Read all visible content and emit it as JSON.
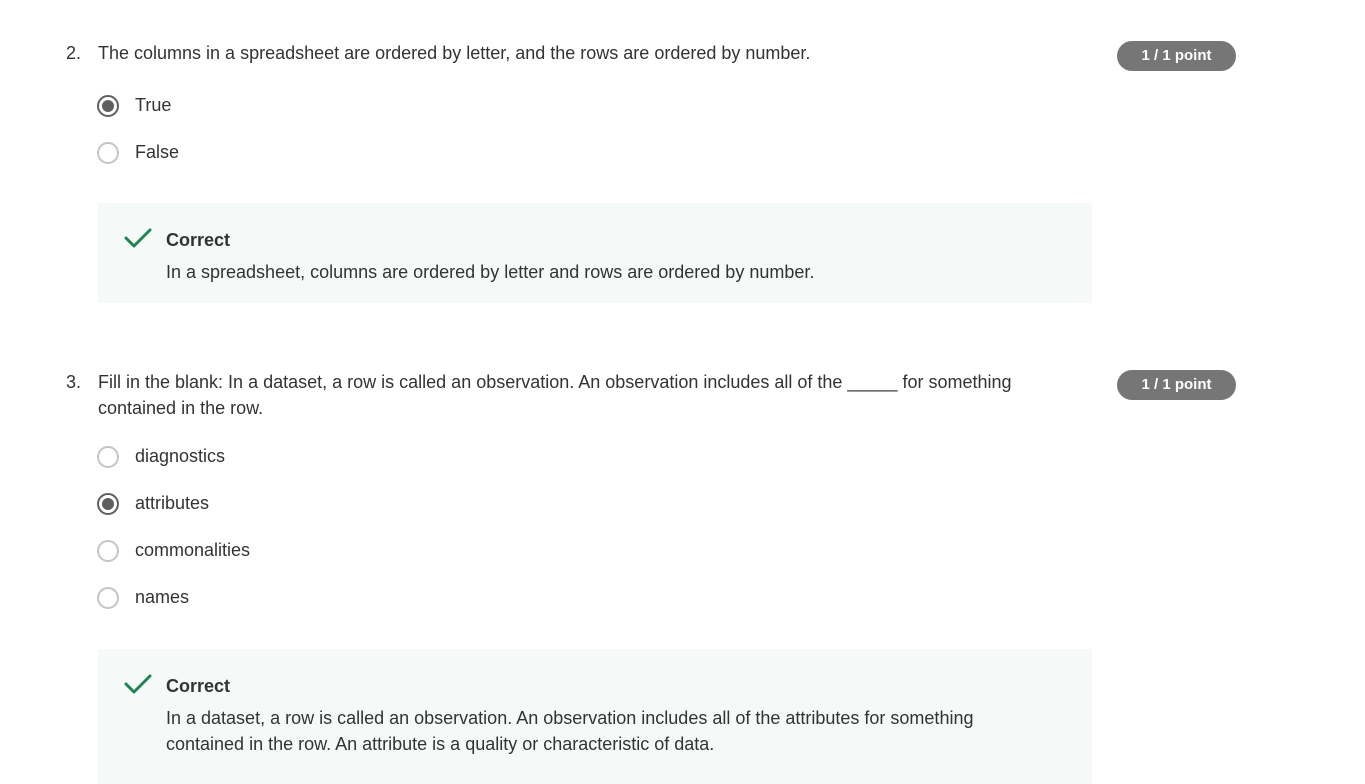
{
  "questions": [
    {
      "number": "2.",
      "text": "The columns in a spreadsheet are ordered by letter, and the rows are ordered by number.",
      "points": "1 / 1 point",
      "options": [
        {
          "label": "True",
          "selected": true
        },
        {
          "label": "False",
          "selected": false
        }
      ],
      "feedback": {
        "title": "Correct",
        "text": "In a spreadsheet, columns are ordered by letter and rows are ordered by number."
      }
    },
    {
      "number": "3.",
      "text": "Fill in the blank: In a dataset, a row is called an observation. An observation includes all of the _____ for something contained in the row.",
      "points": "1 / 1 point",
      "options": [
        {
          "label": "diagnostics",
          "selected": false
        },
        {
          "label": "attributes",
          "selected": true
        },
        {
          "label": "commonalities",
          "selected": false
        },
        {
          "label": "names",
          "selected": false
        }
      ],
      "feedback": {
        "title": "Correct",
        "text": "In a dataset, a row is called an observation. An observation includes all of the attributes for something contained in the row. An attribute is a quality or characteristic of data."
      }
    }
  ],
  "colors": {
    "badge_bg": "#767676",
    "feedback_bg": "#f5f9f8",
    "check_green": "#1f8354",
    "radio_selected": "#5f5f5f",
    "radio_border": "#c4c4c4"
  },
  "icons": {
    "feedback": "checkmark-icon",
    "selected_option": "radio-checked-icon",
    "unselected_option": "radio-unchecked-icon"
  }
}
